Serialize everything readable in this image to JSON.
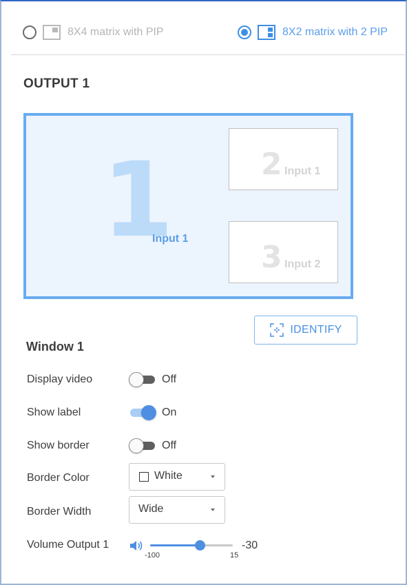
{
  "modes": [
    {
      "label": "8X4 matrix with PIP",
      "selected": false,
      "icon": "layout-pip-icon"
    },
    {
      "label": "8X2 matrix with 2 PIP",
      "selected": true,
      "icon": "layout-2pip-icon"
    }
  ],
  "output": {
    "title": "OUTPUT 1",
    "main_window": {
      "number": "1",
      "label": "Input 1"
    },
    "pips": [
      {
        "number": "2",
        "label": "Input 1"
      },
      {
        "number": "3",
        "label": "Input 2"
      }
    ]
  },
  "identify": {
    "label": "IDENTIFY",
    "icon": "identify-icon"
  },
  "window": {
    "title": "Window 1",
    "display_video": {
      "label": "Display video",
      "state": "Off"
    },
    "show_label": {
      "label": "Show label",
      "state": "On"
    },
    "show_border": {
      "label": "Show border",
      "state": "Off"
    },
    "border_color": {
      "label": "Border Color",
      "value": "White"
    },
    "border_width": {
      "label": "Border Width",
      "value": "Wide"
    },
    "volume": {
      "label": "Volume Output 1",
      "min": "-100",
      "max": "15",
      "value": "-30",
      "fraction": 0.6,
      "icon": "speaker-icon"
    }
  },
  "colors": {
    "accent": "#4e8fe2",
    "preview_border": "#67acf0",
    "preview_bg": "#ecf4fd"
  }
}
